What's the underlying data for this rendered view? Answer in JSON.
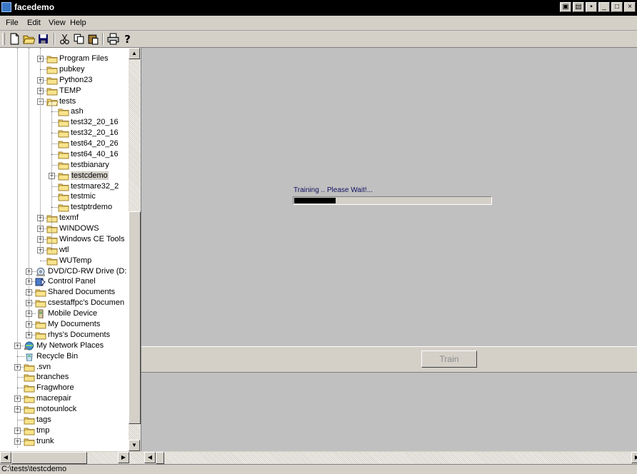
{
  "window": {
    "title": "facedemo"
  },
  "menu": [
    "File",
    "Edit",
    "View",
    "Help"
  ],
  "toolbar_icons": [
    "new-file-icon",
    "open-folder-icon",
    "save-icon",
    "cut-icon",
    "copy-icon",
    "paste-icon",
    "print-icon",
    "help-icon"
  ],
  "tree": [
    {
      "label": "Program Files",
      "indent": 3,
      "expander": "+",
      "icon": "folder"
    },
    {
      "label": "pubkey",
      "indent": 3,
      "expander": "",
      "icon": "folder"
    },
    {
      "label": "Python23",
      "indent": 3,
      "expander": "+",
      "icon": "folder"
    },
    {
      "label": "TEMP",
      "indent": 3,
      "expander": "+",
      "icon": "folder"
    },
    {
      "label": "tests",
      "indent": 3,
      "expander": "-",
      "icon": "folder-open"
    },
    {
      "label": "ash",
      "indent": 4,
      "expander": "",
      "icon": "folder"
    },
    {
      "label": "test32_20_16",
      "indent": 4,
      "expander": "",
      "icon": "folder"
    },
    {
      "label": "test32_20_16",
      "indent": 4,
      "expander": "",
      "icon": "folder"
    },
    {
      "label": "test64_20_26",
      "indent": 4,
      "expander": "",
      "icon": "folder"
    },
    {
      "label": "test64_40_16",
      "indent": 4,
      "expander": "",
      "icon": "folder"
    },
    {
      "label": "testbianary",
      "indent": 4,
      "expander": "",
      "icon": "folder"
    },
    {
      "label": "testcdemo",
      "indent": 4,
      "expander": "+",
      "icon": "folder",
      "selected": true
    },
    {
      "label": "testmare32_2",
      "indent": 4,
      "expander": "",
      "icon": "folder"
    },
    {
      "label": "testmic",
      "indent": 4,
      "expander": "",
      "icon": "folder"
    },
    {
      "label": "testptrdemo",
      "indent": 4,
      "expander": "",
      "icon": "folder"
    },
    {
      "label": "texmf",
      "indent": 3,
      "expander": "+",
      "icon": "folder"
    },
    {
      "label": "WINDOWS",
      "indent": 3,
      "expander": "+",
      "icon": "folder"
    },
    {
      "label": "Windows CE Tools",
      "indent": 3,
      "expander": "+",
      "icon": "folder"
    },
    {
      "label": "wtl",
      "indent": 3,
      "expander": "+",
      "icon": "folder"
    },
    {
      "label": "WUTemp",
      "indent": 3,
      "expander": "",
      "icon": "folder"
    },
    {
      "label": "DVD/CD-RW Drive (D:",
      "indent": 2,
      "expander": "+",
      "icon": "disc"
    },
    {
      "label": "Control Panel",
      "indent": 2,
      "expander": "+",
      "icon": "control-panel"
    },
    {
      "label": "Shared Documents",
      "indent": 2,
      "expander": "+",
      "icon": "folder"
    },
    {
      "label": "csestaffpc's Documen",
      "indent": 2,
      "expander": "+",
      "icon": "folder"
    },
    {
      "label": "Mobile Device",
      "indent": 2,
      "expander": "+",
      "icon": "mobile"
    },
    {
      "label": "My Documents",
      "indent": 2,
      "expander": "+",
      "icon": "folder"
    },
    {
      "label": "rhys's Documents",
      "indent": 2,
      "expander": "+",
      "icon": "folder"
    },
    {
      "label": "My Network Places",
      "indent": 1,
      "expander": "+",
      "icon": "network"
    },
    {
      "label": "Recycle Bin",
      "indent": 1,
      "expander": "",
      "icon": "recycle"
    },
    {
      "label": ".svn",
      "indent": 1,
      "expander": "+",
      "icon": "folder"
    },
    {
      "label": "branches",
      "indent": 1,
      "expander": "",
      "icon": "folder"
    },
    {
      "label": "Fragwhore",
      "indent": 1,
      "expander": "",
      "icon": "folder"
    },
    {
      "label": "macrepair",
      "indent": 1,
      "expander": "+",
      "icon": "folder"
    },
    {
      "label": "motounlock",
      "indent": 1,
      "expander": "+",
      "icon": "folder"
    },
    {
      "label": "tags",
      "indent": 1,
      "expander": "",
      "icon": "folder"
    },
    {
      "label": "tmp",
      "indent": 1,
      "expander": "+",
      "icon": "folder"
    },
    {
      "label": "trunk",
      "indent": 1,
      "expander": "+",
      "icon": "folder"
    }
  ],
  "progress": {
    "label": "Training .. Please Wait!...",
    "fraction": 0.21
  },
  "train_button": "Train",
  "status": "C:\\tests\\testcdemo"
}
